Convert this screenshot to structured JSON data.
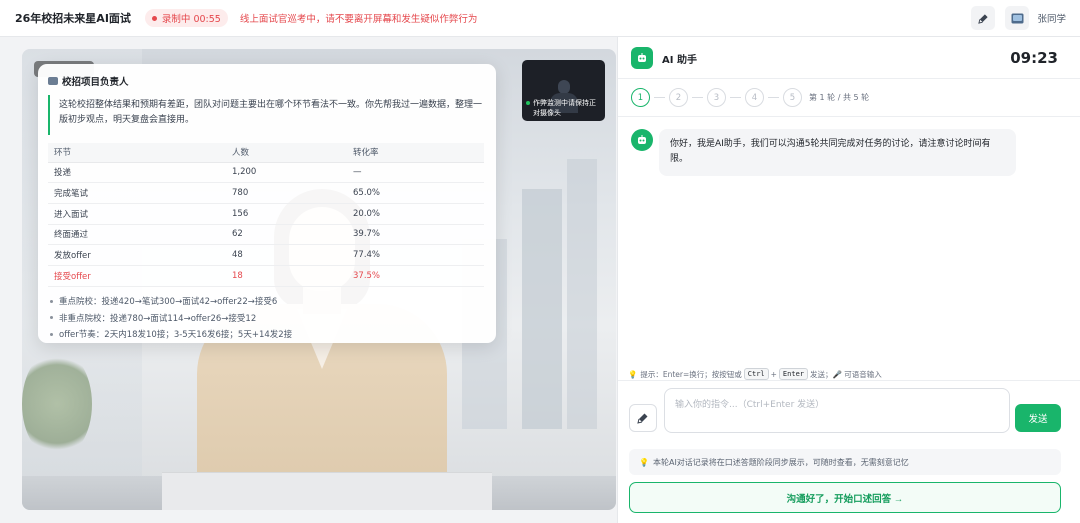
{
  "app": {
    "title": "26年校招未来星AI面试"
  },
  "recording": {
    "label": "录制中 00:55"
  },
  "warning": "线上面试官巡考中，请不要离开屏幕和发生疑似作弊行为",
  "user": {
    "name": "张同学"
  },
  "icons": {
    "mic": "microphone-icon",
    "screen": "screen-share-icon",
    "bulb": "lightbulb-icon",
    "ai": "robot-icon"
  },
  "colors": {
    "accent": "#19b56b",
    "danger": "#e5484d"
  },
  "camera": {
    "tip": "作弊监测中请保持正对摄像头"
  },
  "card": {
    "title": "校招项目负责人",
    "quote": "这轮校招整体结果和预期有差距，团队对问题主要出在哪个环节看法不一致。你先帮我过一遍数据，整理一版初步观点，明天复盘会直接用。",
    "columns": [
      "环节",
      "人数",
      "转化率"
    ],
    "rows": [
      [
        "投递",
        "1,200",
        "—"
      ],
      [
        "完成笔试",
        "780",
        "65.0%"
      ],
      [
        "进入面试",
        "156",
        "20.0%"
      ],
      [
        "终面通过",
        "62",
        "39.7%"
      ],
      [
        "发放offer",
        "48",
        "77.4%"
      ],
      [
        "接受offer",
        "18",
        "37.5%"
      ]
    ],
    "bullets": [
      "重点院校：投递420→笔试300→面试42→offer22→接受6",
      "非重点院校：投递780→面试114→offer26→接受12",
      "offer节奏：2天内18发10接；3-5天16发6接；5天+14发2接"
    ]
  },
  "assistant": {
    "title": "AI 助手",
    "timer": "09:23",
    "steps": [
      "1",
      "2",
      "3",
      "4",
      "5"
    ],
    "current_step": 1,
    "round_text": "第 1 轮 / 共 5 轮",
    "message": "你好，我是AI助手，我们可以沟通5轮共同完成对任务的讨论，请注意讨论时间有限。",
    "hint": {
      "prefix": "提示：Enter=换行；按按钮或",
      "key1": "Ctrl",
      "plus": "+",
      "key2": "Enter",
      "suffix": "发送；🎤 可语音输入"
    },
    "input_placeholder": "输入你的指令...（Ctrl+Enter 发送）",
    "send_label": "发送",
    "note": "本轮AI对话记录将在口述答题阶段同步展示，可随时查看，无需刻意记忆",
    "cta": "沟通好了，开始口述回答 →"
  }
}
